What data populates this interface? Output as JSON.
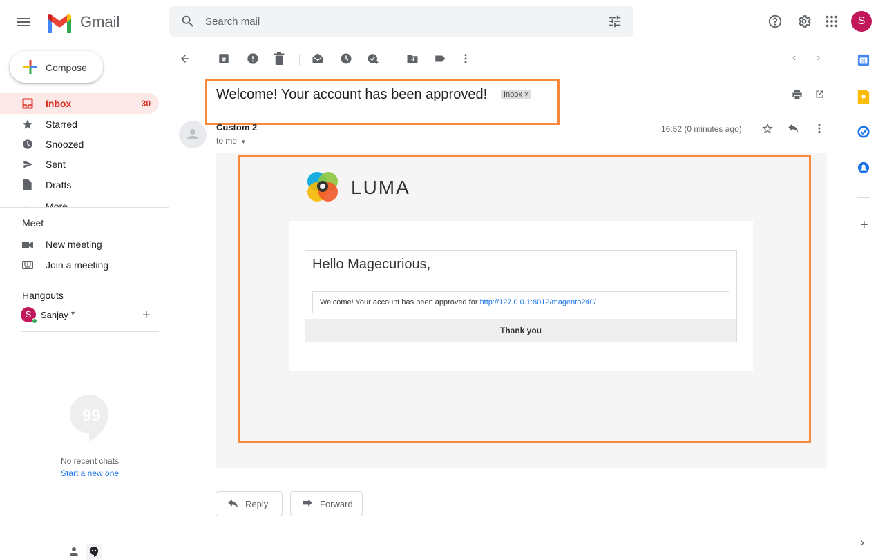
{
  "app": {
    "name": "Gmail"
  },
  "search": {
    "placeholder": "Search mail"
  },
  "account": {
    "initial": "S"
  },
  "compose": {
    "label": "Compose"
  },
  "nav": {
    "items": [
      {
        "label": "Inbox",
        "count": "30",
        "icon": "inbox-icon",
        "active": true
      },
      {
        "label": "Starred",
        "icon": "star-icon"
      },
      {
        "label": "Snoozed",
        "icon": "clock-icon"
      },
      {
        "label": "Sent",
        "icon": "send-icon"
      },
      {
        "label": "Drafts",
        "icon": "draft-icon"
      }
    ],
    "more": "More"
  },
  "meet": {
    "title": "Meet",
    "new_meeting": "New meeting",
    "join": "Join a meeting"
  },
  "hangouts": {
    "title": "Hangouts",
    "user_initial": "S",
    "user": "Sanjay",
    "no_chats": "No recent chats",
    "start_new": "Start a new one"
  },
  "message": {
    "subject": "Welcome! Your account has been approved!",
    "label_chip": "Inbox ×",
    "sender": "Custom 2",
    "to": "to me",
    "time": "16:52 (0 minutes ago)"
  },
  "email": {
    "brand": "LUMA",
    "greeting": "Hello Magecurious,",
    "body_text": "Welcome! Your account has been approved for ",
    "link": "http://127.0.0.1:8012/magento240/",
    "thanks": "Thank you"
  },
  "actions": {
    "reply": "Reply",
    "forward": "Forward"
  },
  "colors": {
    "highlight": "#f6893a",
    "inbox_active": "#d93025",
    "avatar": "#c2185b"
  }
}
